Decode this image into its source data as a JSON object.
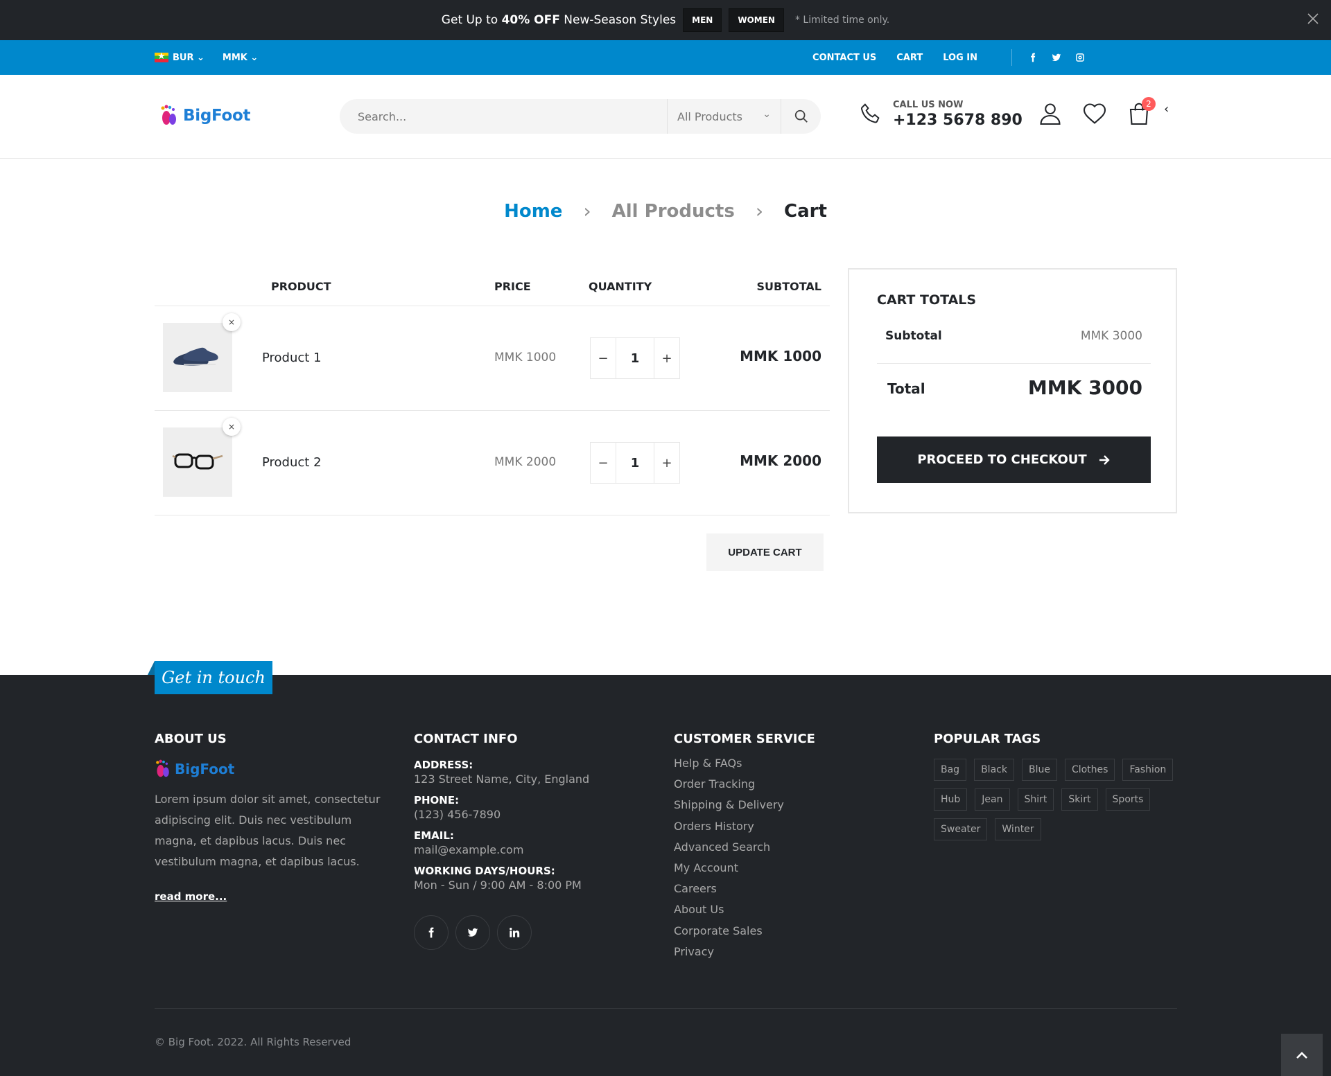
{
  "promo": {
    "text_pre": "Get Up to ",
    "text_bold": "40% OFF",
    "text_post": " New-Season Styles",
    "btn_men": "MEN",
    "btn_women": "WOMEN",
    "note": "* Limited time only.",
    "close_icon": "close-icon"
  },
  "topbar": {
    "language": "BUR",
    "currency": "MMK",
    "links": [
      "CONTACT US",
      "CART",
      "LOG IN"
    ],
    "social": [
      "facebook-icon",
      "twitter-icon",
      "instagram-icon"
    ]
  },
  "header": {
    "logo_text": "BigFoot",
    "search_placeholder": "Search...",
    "search_category": "All Products",
    "call_label": "CALL US NOW",
    "call_number": "+123 5678 890",
    "cart_count": "2"
  },
  "breadcrumb": {
    "home": "Home",
    "all": "All Products",
    "current": "Cart"
  },
  "cart": {
    "headers": {
      "product": "PRODUCT",
      "price": "PRICE",
      "quantity": "QUANTITY",
      "subtotal": "SUBTOTAL"
    },
    "items": [
      {
        "name": "Product 1",
        "price": "MMK 1000",
        "qty": "1",
        "subtotal": "MMK 1000",
        "image": "shoes-image"
      },
      {
        "name": "Product 2",
        "price": "MMK 2000",
        "qty": "1",
        "subtotal": "MMK 2000",
        "image": "glasses-image"
      }
    ],
    "remove_label": "×",
    "minus": "−",
    "plus": "+",
    "update_label": "UPDATE CART"
  },
  "totals": {
    "title": "CART TOTALS",
    "subtotal_label": "Subtotal",
    "subtotal_value": "MMK 3000",
    "total_label": "Total",
    "total_value": "MMK 3000",
    "checkout_label": "PROCEED TO CHECKOUT"
  },
  "footer": {
    "get_in_touch": "Get in touch",
    "about": {
      "title": "ABOUT US",
      "logo_text": "BigFoot",
      "text": "Lorem ipsum dolor sit amet, consectetur adipiscing elit. Duis nec vestibulum magna, et dapibus lacus. Duis nec vestibulum magna, et dapibus lacus.",
      "read_more": "read more..."
    },
    "contact": {
      "title": "CONTACT INFO",
      "address_label": "ADDRESS:",
      "address": "123 Street Name, City, England",
      "phone_label": "PHONE:",
      "phone": "(123) 456-7890",
      "email_label": "EMAIL:",
      "email": "mail@example.com",
      "hours_label": "WORKING DAYS/HOURS:",
      "hours": "Mon - Sun / 9:00 AM - 8:00 PM"
    },
    "service": {
      "title": "CUSTOMER SERVICE",
      "links": [
        "Help & FAQs",
        "Order Tracking",
        "Shipping & Delivery",
        "Orders History",
        "Advanced Search",
        "My Account",
        "Careers",
        "About Us",
        "Corporate Sales",
        "Privacy"
      ]
    },
    "tags": {
      "title": "POPULAR TAGS",
      "items": [
        "Bag",
        "Black",
        "Blue",
        "Clothes",
        "Fashion",
        "Hub",
        "Jean",
        "Shirt",
        "Skirt",
        "Sports",
        "Sweater",
        "Winter"
      ]
    },
    "copyright": "© Big Foot. 2022. All Rights Reserved"
  },
  "colors": {
    "accent": "#0088cc",
    "dark": "#222529",
    "badge": "#ff5b5b"
  }
}
